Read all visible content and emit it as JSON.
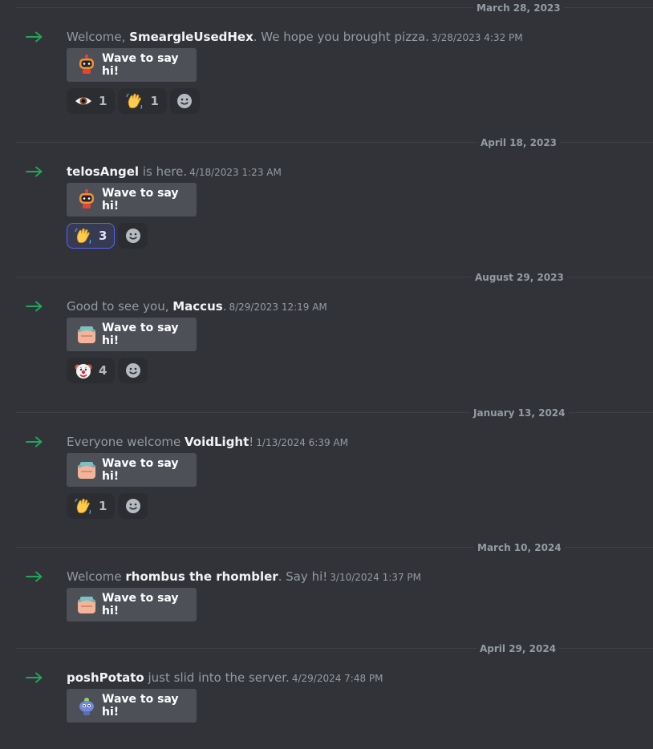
{
  "messages": [
    {
      "date": "March 28, 2023",
      "parts": [
        {
          "t": "Welcome, "
        },
        {
          "t": "SmeargleUsedHex",
          "b": 1
        },
        {
          "t": ". We hope you brought pizza."
        }
      ],
      "timestamp": "3/28/2023 4:32 PM",
      "sticker": "robot-sticker-icon",
      "button": "Wave to say hi!",
      "reactions": [
        {
          "emoji": "eye-icon",
          "count": "1",
          "me": false
        },
        {
          "emoji": "waving-hand-icon",
          "count": "1",
          "me": false
        }
      ]
    },
    {
      "date": "April 18, 2023",
      "parts": [
        {
          "t": "telosAngel",
          "b": 1
        },
        {
          "t": " is here."
        }
      ],
      "timestamp": "4/18/2023 1:23 AM",
      "sticker": "robot-sticker-icon",
      "button": "Wave to say hi!",
      "reactions": [
        {
          "emoji": "waving-hand-icon",
          "count": "3",
          "me": true
        }
      ]
    },
    {
      "date": "August 29, 2023",
      "parts": [
        {
          "t": "Good to see you, "
        },
        {
          "t": "Maccus",
          "b": 1
        },
        {
          "t": "."
        }
      ],
      "timestamp": "8/29/2023 12:19 AM",
      "sticker": "hand-sticker-icon",
      "button": "Wave to say hi!",
      "reactions": [
        {
          "emoji": "clown-face-icon",
          "count": "4",
          "me": false
        }
      ]
    },
    {
      "date": "January 13, 2024",
      "parts": [
        {
          "t": "Everyone welcome "
        },
        {
          "t": "VoidLight",
          "b": 1
        },
        {
          "t": "!"
        }
      ],
      "timestamp": "1/13/2024 6:39 AM",
      "sticker": "hand-sticker-icon",
      "button": "Wave to say hi!",
      "reactions": [
        {
          "emoji": "waving-hand-icon",
          "count": "1",
          "me": false
        }
      ]
    },
    {
      "date": "March 10, 2024",
      "parts": [
        {
          "t": "Welcome "
        },
        {
          "t": "rhombus the rhombler",
          "b": 1
        },
        {
          "t": ". Say hi!"
        }
      ],
      "timestamp": "3/10/2024 1:37 PM",
      "sticker": "hand-sticker-icon",
      "button": "Wave to say hi!",
      "reactions": []
    },
    {
      "date": "April 29, 2024",
      "parts": [
        {
          "t": "poshPotato",
          "b": 1
        },
        {
          "t": " just slid into the server."
        }
      ],
      "timestamp": "4/29/2024 7:48 PM",
      "sticker": "wumpus-sticker-icon",
      "button": "Wave to say hi!",
      "reactions": []
    }
  ],
  "colors": {
    "background": "#313338",
    "join_arrow": "#23a55a",
    "button": "#4e5058",
    "reaction": "#2b2d31",
    "reaction_active": "#373a53",
    "reaction_active_border": "#5865f2"
  }
}
